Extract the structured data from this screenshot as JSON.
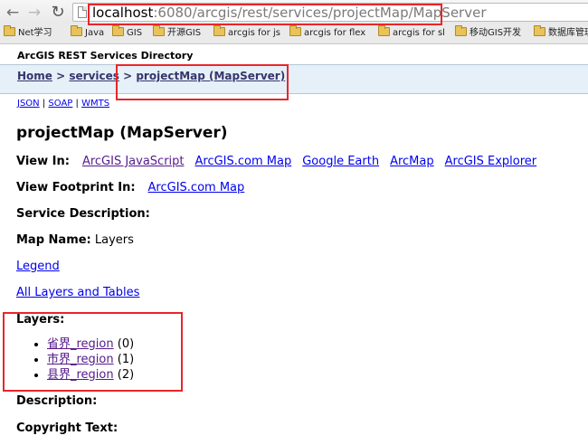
{
  "browser": {
    "url_host": "localhost",
    "url_rest": ":6080/arcgis/rest/services/projectMap/MapServer",
    "bookmarks": [
      "Net学习",
      "Java",
      "GIS",
      "开源GIS",
      "arcgis for js",
      "arcgis for flex",
      "arcgis for sl",
      "移动GIS开发",
      "数据库管理"
    ]
  },
  "page": {
    "directory_title": "ArcGIS REST Services Directory",
    "breadcrumb": {
      "home": "Home",
      "sep1": ">",
      "services": "services",
      "sep2": ">",
      "current": "projectMap (MapServer)"
    },
    "formats": {
      "json": "JSON",
      "sep1": "|",
      "soap": "SOAP",
      "sep2": "|",
      "wmts": "WMTS"
    },
    "title": "projectMap (MapServer)",
    "view_in": {
      "label": "View In:",
      "links": [
        "ArcGIS JavaScript",
        "ArcGIS.com Map",
        "Google Earth",
        "ArcMap",
        "ArcGIS Explorer"
      ]
    },
    "view_footprint": {
      "label": "View Footprint In:",
      "link": "ArcGIS.com Map"
    },
    "service_description_label": "Service Description:",
    "map_name": {
      "label": "Map Name:",
      "value": "Layers"
    },
    "legend_link": "Legend",
    "all_layers_link": "All Layers and Tables",
    "layers": {
      "label": "Layers:",
      "items": [
        {
          "name": "省界_region",
          "id": "(0)"
        },
        {
          "name": "市界_region",
          "id": "(1)"
        },
        {
          "name": "县界_region",
          "id": "(2)"
        }
      ]
    },
    "description_label": "Description:",
    "copyright_label": "Copyright Text:"
  }
}
